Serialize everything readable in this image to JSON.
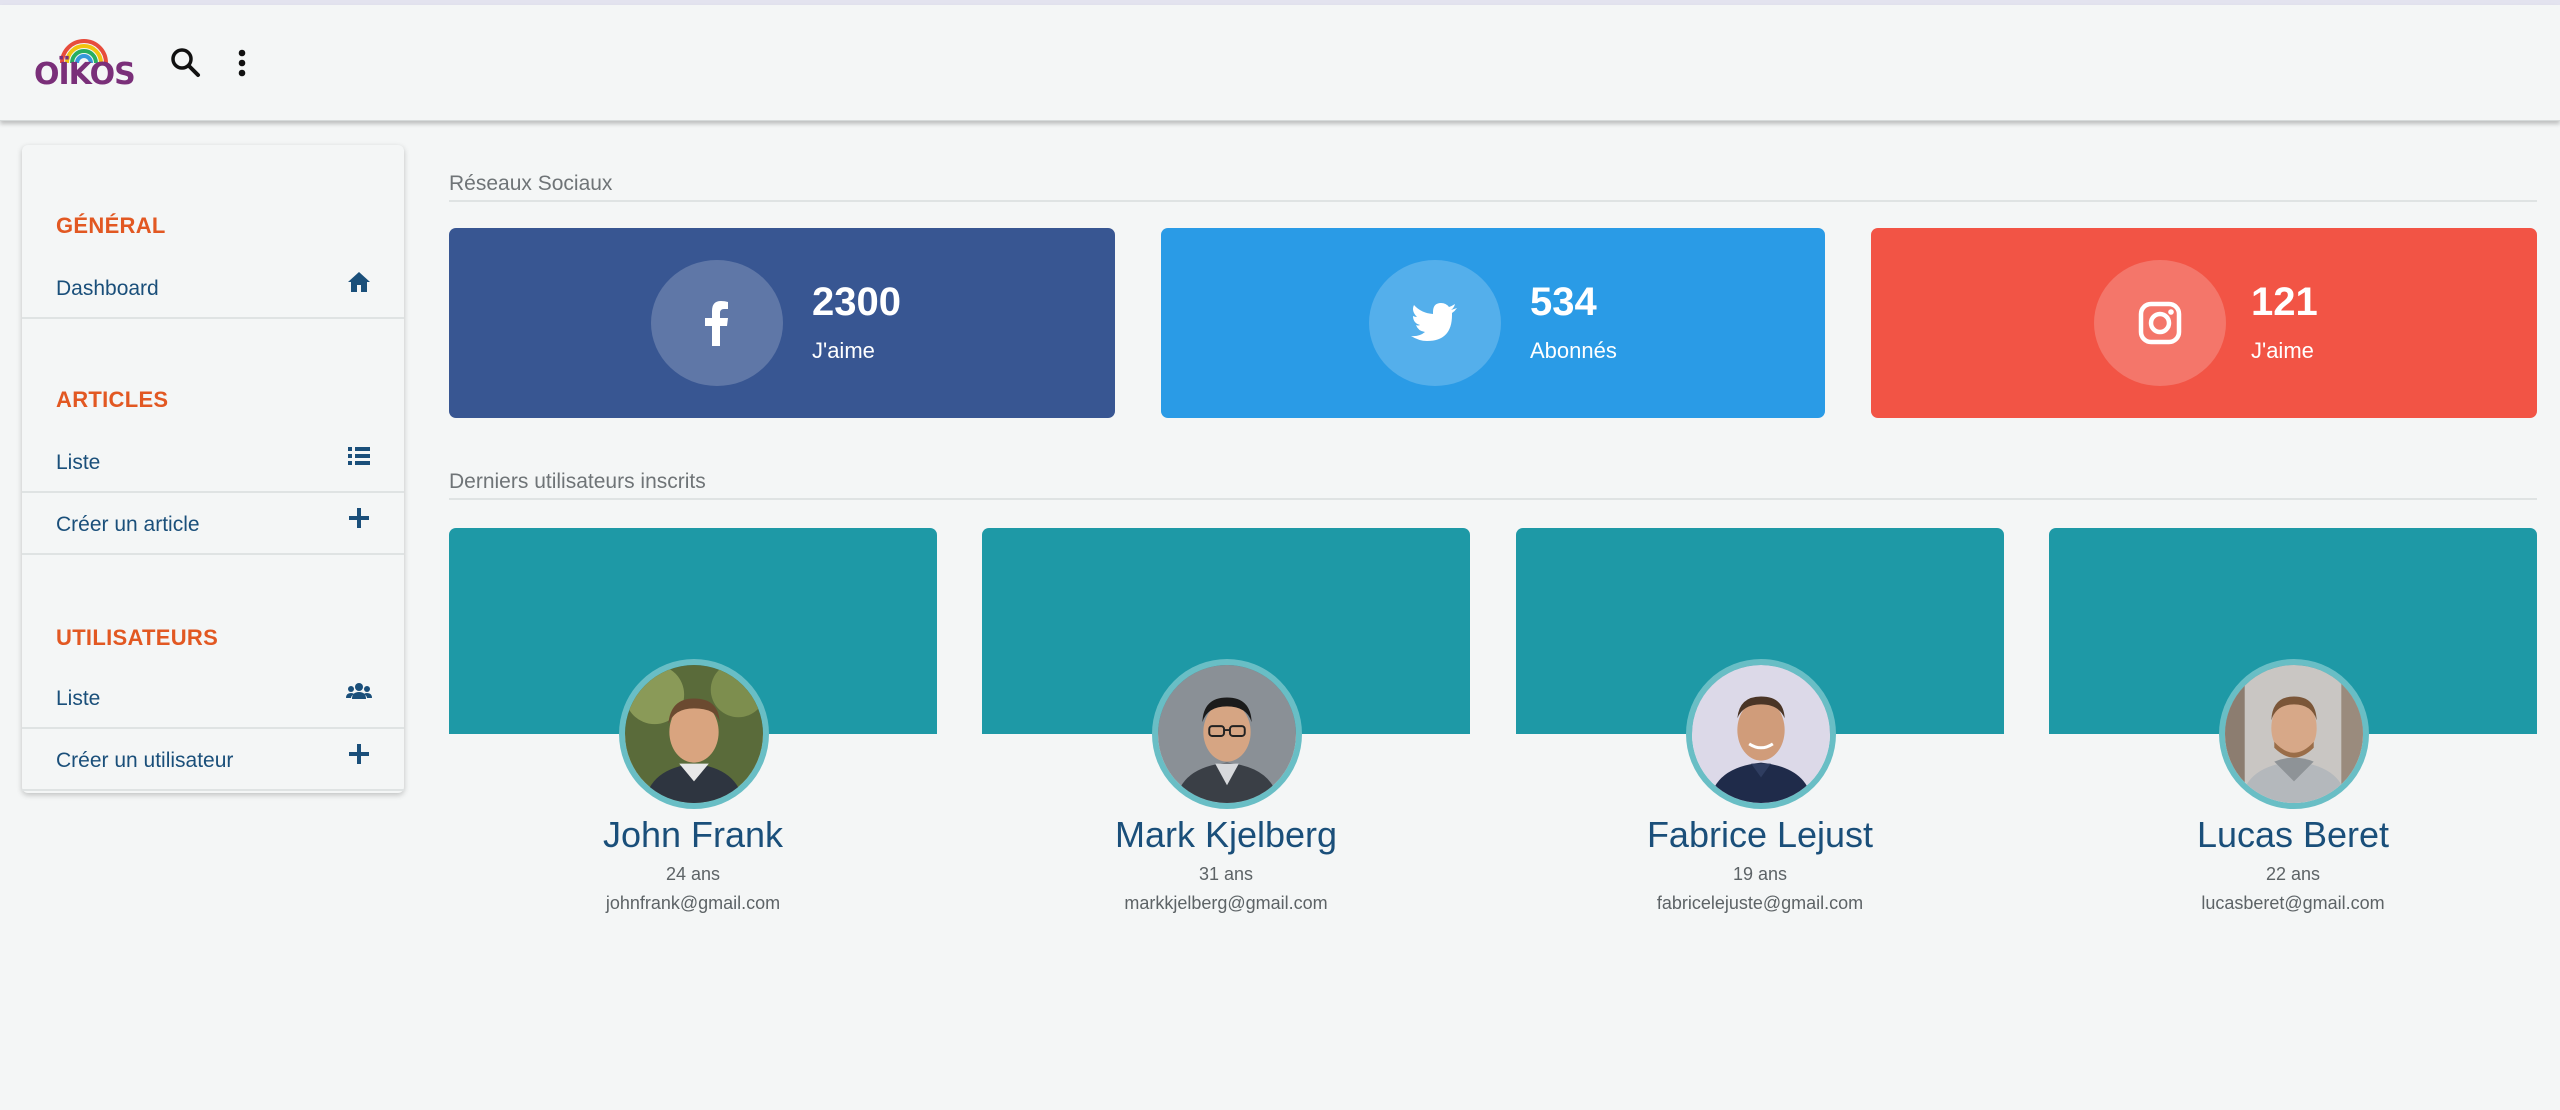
{
  "app": {
    "logo_text": "OÏKOS"
  },
  "colors": {
    "accent_orange": "#e25822",
    "nav_blue": "#1a4f7a",
    "facebook": "#385692",
    "twitter": "#2a9be6",
    "instagram": "#f25445",
    "user_banner": "#1e99a6"
  },
  "topbar": {
    "icons": [
      "search-icon",
      "more-vertical-icon"
    ]
  },
  "sidebar": {
    "sections": [
      {
        "title": "GÉNÉRAL",
        "items": [
          {
            "label": "Dashboard",
            "icon": "home-icon"
          }
        ]
      },
      {
        "title": "ARTICLES",
        "items": [
          {
            "label": "Liste",
            "icon": "list-icon"
          },
          {
            "label": "Créer un article",
            "icon": "plus-icon"
          }
        ]
      },
      {
        "title": "UTILISATEURS",
        "items": [
          {
            "label": "Liste",
            "icon": "users-icon"
          },
          {
            "label": "Créer un utilisateur",
            "icon": "plus-icon"
          }
        ]
      }
    ]
  },
  "main": {
    "social_title": "Réseaux Sociaux",
    "social": [
      {
        "network": "facebook",
        "icon": "facebook-icon",
        "value": "2300",
        "label": "J'aime"
      },
      {
        "network": "twitter",
        "icon": "twitter-icon",
        "value": "534",
        "label": "Abonnés"
      },
      {
        "network": "instagram",
        "icon": "instagram-icon",
        "value": "121",
        "label": "J'aime"
      }
    ],
    "users_title": "Derniers utilisateurs inscrits",
    "users": [
      {
        "name": "John Frank",
        "age": "24 ans",
        "email": "johnfrank@gmail.com"
      },
      {
        "name": "Mark Kjelberg",
        "age": "31 ans",
        "email": "markkjelberg@gmail.com"
      },
      {
        "name": "Fabrice Lejust",
        "age": "19 ans",
        "email": "fabricelejuste@gmail.com"
      },
      {
        "name": "Lucas Beret",
        "age": "22 ans",
        "email": "lucasberet@gmail.com"
      }
    ]
  }
}
